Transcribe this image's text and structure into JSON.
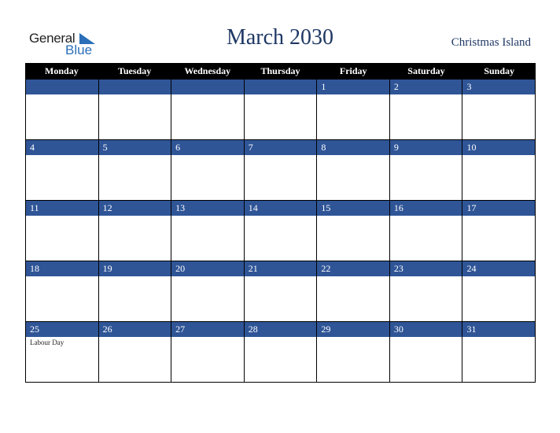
{
  "logo": {
    "line1": "General",
    "line2": "Blue"
  },
  "title": "March 2030",
  "region": "Christmas Island",
  "weekdays": [
    "Monday",
    "Tuesday",
    "Wednesday",
    "Thursday",
    "Friday",
    "Saturday",
    "Sunday"
  ],
  "weeks": [
    [
      "",
      "",
      "",
      "",
      "1",
      "2",
      "3"
    ],
    [
      "4",
      "5",
      "6",
      "7",
      "8",
      "9",
      "10"
    ],
    [
      "11",
      "12",
      "13",
      "14",
      "15",
      "16",
      "17"
    ],
    [
      "18",
      "19",
      "20",
      "21",
      "22",
      "23",
      "24"
    ],
    [
      "25",
      "26",
      "27",
      "28",
      "29",
      "30",
      "31"
    ]
  ],
  "events": {
    "25": "Labour Day"
  },
  "colors": {
    "header_bg": "#000000",
    "date_bar": "#2f5597",
    "title": "#1f3864"
  }
}
